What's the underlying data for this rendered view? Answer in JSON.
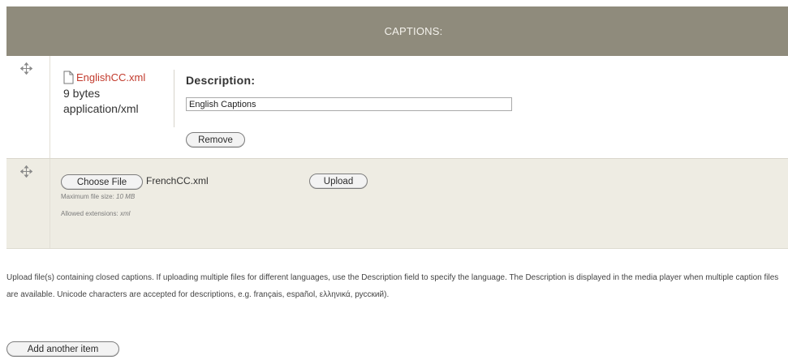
{
  "header": {
    "title": "CAPTIONS:"
  },
  "rows": [
    {
      "file": {
        "name": "EnglishCC.xml",
        "size": "9 bytes",
        "mime": "application/xml"
      },
      "description": {
        "label": "Description:",
        "value": "English Captions"
      },
      "remove_label": "Remove"
    },
    {
      "choose_label": "Choose File",
      "chosen_file": "FrenchCC.xml",
      "upload_label": "Upload",
      "max_size_label": "Maximum file size:",
      "max_size_value": "10 MB",
      "ext_label": "Allowed extensions:",
      "ext_value": "xml"
    }
  ],
  "help_text": "Upload file(s) containing closed captions. If uploading multiple files for different languages, use the Description field to specify the language. The Description is displayed in the media player when multiple caption files are available. Unicode characters are accepted for descriptions, e.g. français, español, ελληνικά, русский).",
  "add_another_label": "Add another item",
  "icons": {
    "drag": "drag-handle-icon",
    "file": "document-icon"
  },
  "colors": {
    "header_bg": "#8f8b7c",
    "file_link": "#c23a2c",
    "row_alt_bg": "#eeece3"
  }
}
